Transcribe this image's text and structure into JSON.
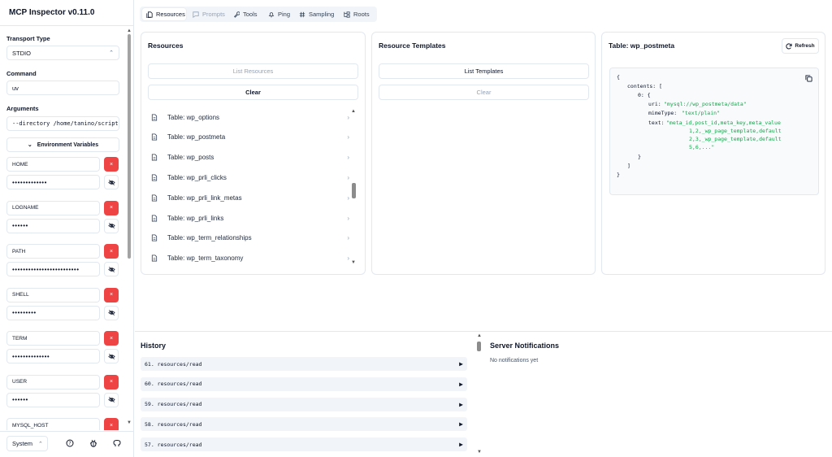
{
  "app": {
    "title": "MCP Inspector v0.11.0"
  },
  "sidebar": {
    "transport_label": "Transport Type",
    "transport_value": "STDIO",
    "command_label": "Command",
    "command_value": "uv",
    "arguments_label": "Arguments",
    "arguments_value": "--directory /home/tanino/scripts",
    "env_toggle_label": "Environment Variables",
    "env": [
      {
        "key": "HOME",
        "value": "•••••••••••••"
      },
      {
        "key": "LOGNAME",
        "value": "••••••"
      },
      {
        "key": "PATH",
        "value": "•••••••••••••••••••••••••"
      },
      {
        "key": "SHELL",
        "value": "•••••••••"
      },
      {
        "key": "TERM",
        "value": "••••••••••••••"
      },
      {
        "key": "USER",
        "value": "••••••"
      },
      {
        "key": "MYSQL_HOST",
        "value": ""
      }
    ],
    "delete_glyph": "×",
    "theme_value": "System"
  },
  "tabs": [
    {
      "label": "Resources",
      "icon": "files-icon",
      "state": "active"
    },
    {
      "label": "Prompts",
      "icon": "message-icon",
      "state": "disabled"
    },
    {
      "label": "Tools",
      "icon": "wrench-icon",
      "state": "normal"
    },
    {
      "label": "Ping",
      "icon": "bell-icon",
      "state": "normal"
    },
    {
      "label": "Sampling",
      "icon": "hash-icon",
      "state": "normal"
    },
    {
      "label": "Roots",
      "icon": "folder-tree-icon",
      "state": "normal"
    }
  ],
  "resources": {
    "title": "Resources",
    "list_button": "List Resources",
    "clear_button": "Clear",
    "items": [
      "Table: wp_options",
      "Table: wp_postmeta",
      "Table: wp_posts",
      "Table: wp_prli_clicks",
      "Table: wp_prli_link_metas",
      "Table: wp_prli_links",
      "Table: wp_term_relationships",
      "Table: wp_term_taxonomy"
    ]
  },
  "templates": {
    "title": "Resource Templates",
    "list_button": "List Templates",
    "clear_button": "Clear"
  },
  "detail": {
    "title": "Table: wp_postmeta",
    "refresh_button": "Refresh",
    "code": {
      "open": "{",
      "contents_key": "contents: [",
      "item_key": "0: {",
      "uri_key": "uri:",
      "uri_val": "\"mysql://wp_postmeta/data\"",
      "mime_key": "mimeType:",
      "mime_val": "\"text/plain\"",
      "text_key": "text:",
      "text_l1": "\"meta_id,post_id,meta_key,meta_value",
      "text_l2": "1,2,_wp_page_template,default",
      "text_l3": "2,3,_wp_page_template,default",
      "text_l4": "5,6,...\"",
      "item_close": "}",
      "array_close": "]",
      "close": "}"
    }
  },
  "history": {
    "title": "History",
    "items": [
      "61. resources/read",
      "60. resources/read",
      "59. resources/read",
      "58. resources/read",
      "57. resources/read"
    ],
    "play_glyph": "▶"
  },
  "notifications": {
    "title": "Server Notifications",
    "empty": "No notifications yet"
  }
}
